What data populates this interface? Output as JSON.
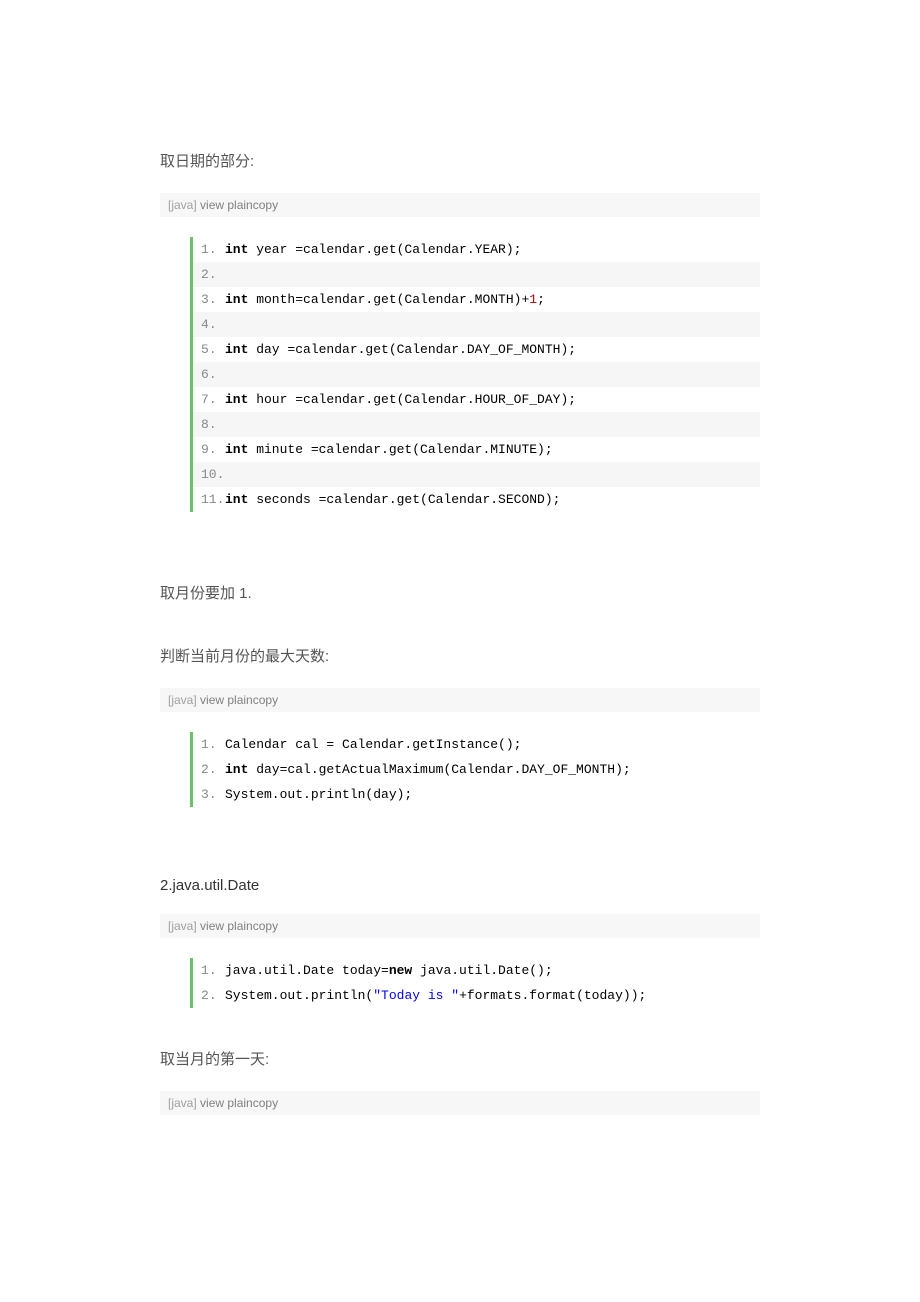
{
  "headings": {
    "h1": "取日期的部分:",
    "h2": "取月份要加 1.",
    "h3": "判断当前月份的最大天数:",
    "h4": "2.java.util.Date",
    "h5": "取当月的第一天:"
  },
  "codeHeader": {
    "lang": "[java]",
    "link1": "view plain",
    "link2": "copy"
  },
  "block1": [
    {
      "t1": "int",
      "t2": " year =calendar.get(Calendar.YEAR);"
    },
    {
      "t2": ""
    },
    {
      "t1": "int",
      "t2": " month=calendar.get(Calendar.MONTH)+",
      "t3": "1",
      "t4": ";"
    },
    {
      "t2": ""
    },
    {
      "t1": "int",
      "t2": " day =calendar.get(Calendar.DAY_OF_MONTH);"
    },
    {
      "t2": ""
    },
    {
      "t1": "int",
      "t2": " hour =calendar.get(Calendar.HOUR_OF_DAY);"
    },
    {
      "t2": ""
    },
    {
      "t1": "int",
      "t2": " minute =calendar.get(Calendar.MINUTE);"
    },
    {
      "t2": ""
    },
    {
      "t1": "int",
      "t2": " seconds =calendar.get(Calendar.SECOND);"
    }
  ],
  "block2": [
    {
      "t2": "Calendar cal = Calendar.getInstance();"
    },
    {
      "t1": "int",
      "t2": " day=cal.getActualMaximum(Calendar.DAY_OF_MONTH);"
    },
    {
      "t2": "System.out.println(day);"
    }
  ],
  "block3": [
    {
      "t2a": "java.util.Date today=",
      "t1": "new",
      "t2b": " java.util.Date();"
    },
    {
      "t2a": "System.out.println(",
      "ts": "\"Today is \"",
      "t2b": "+formats.format(today));"
    }
  ]
}
